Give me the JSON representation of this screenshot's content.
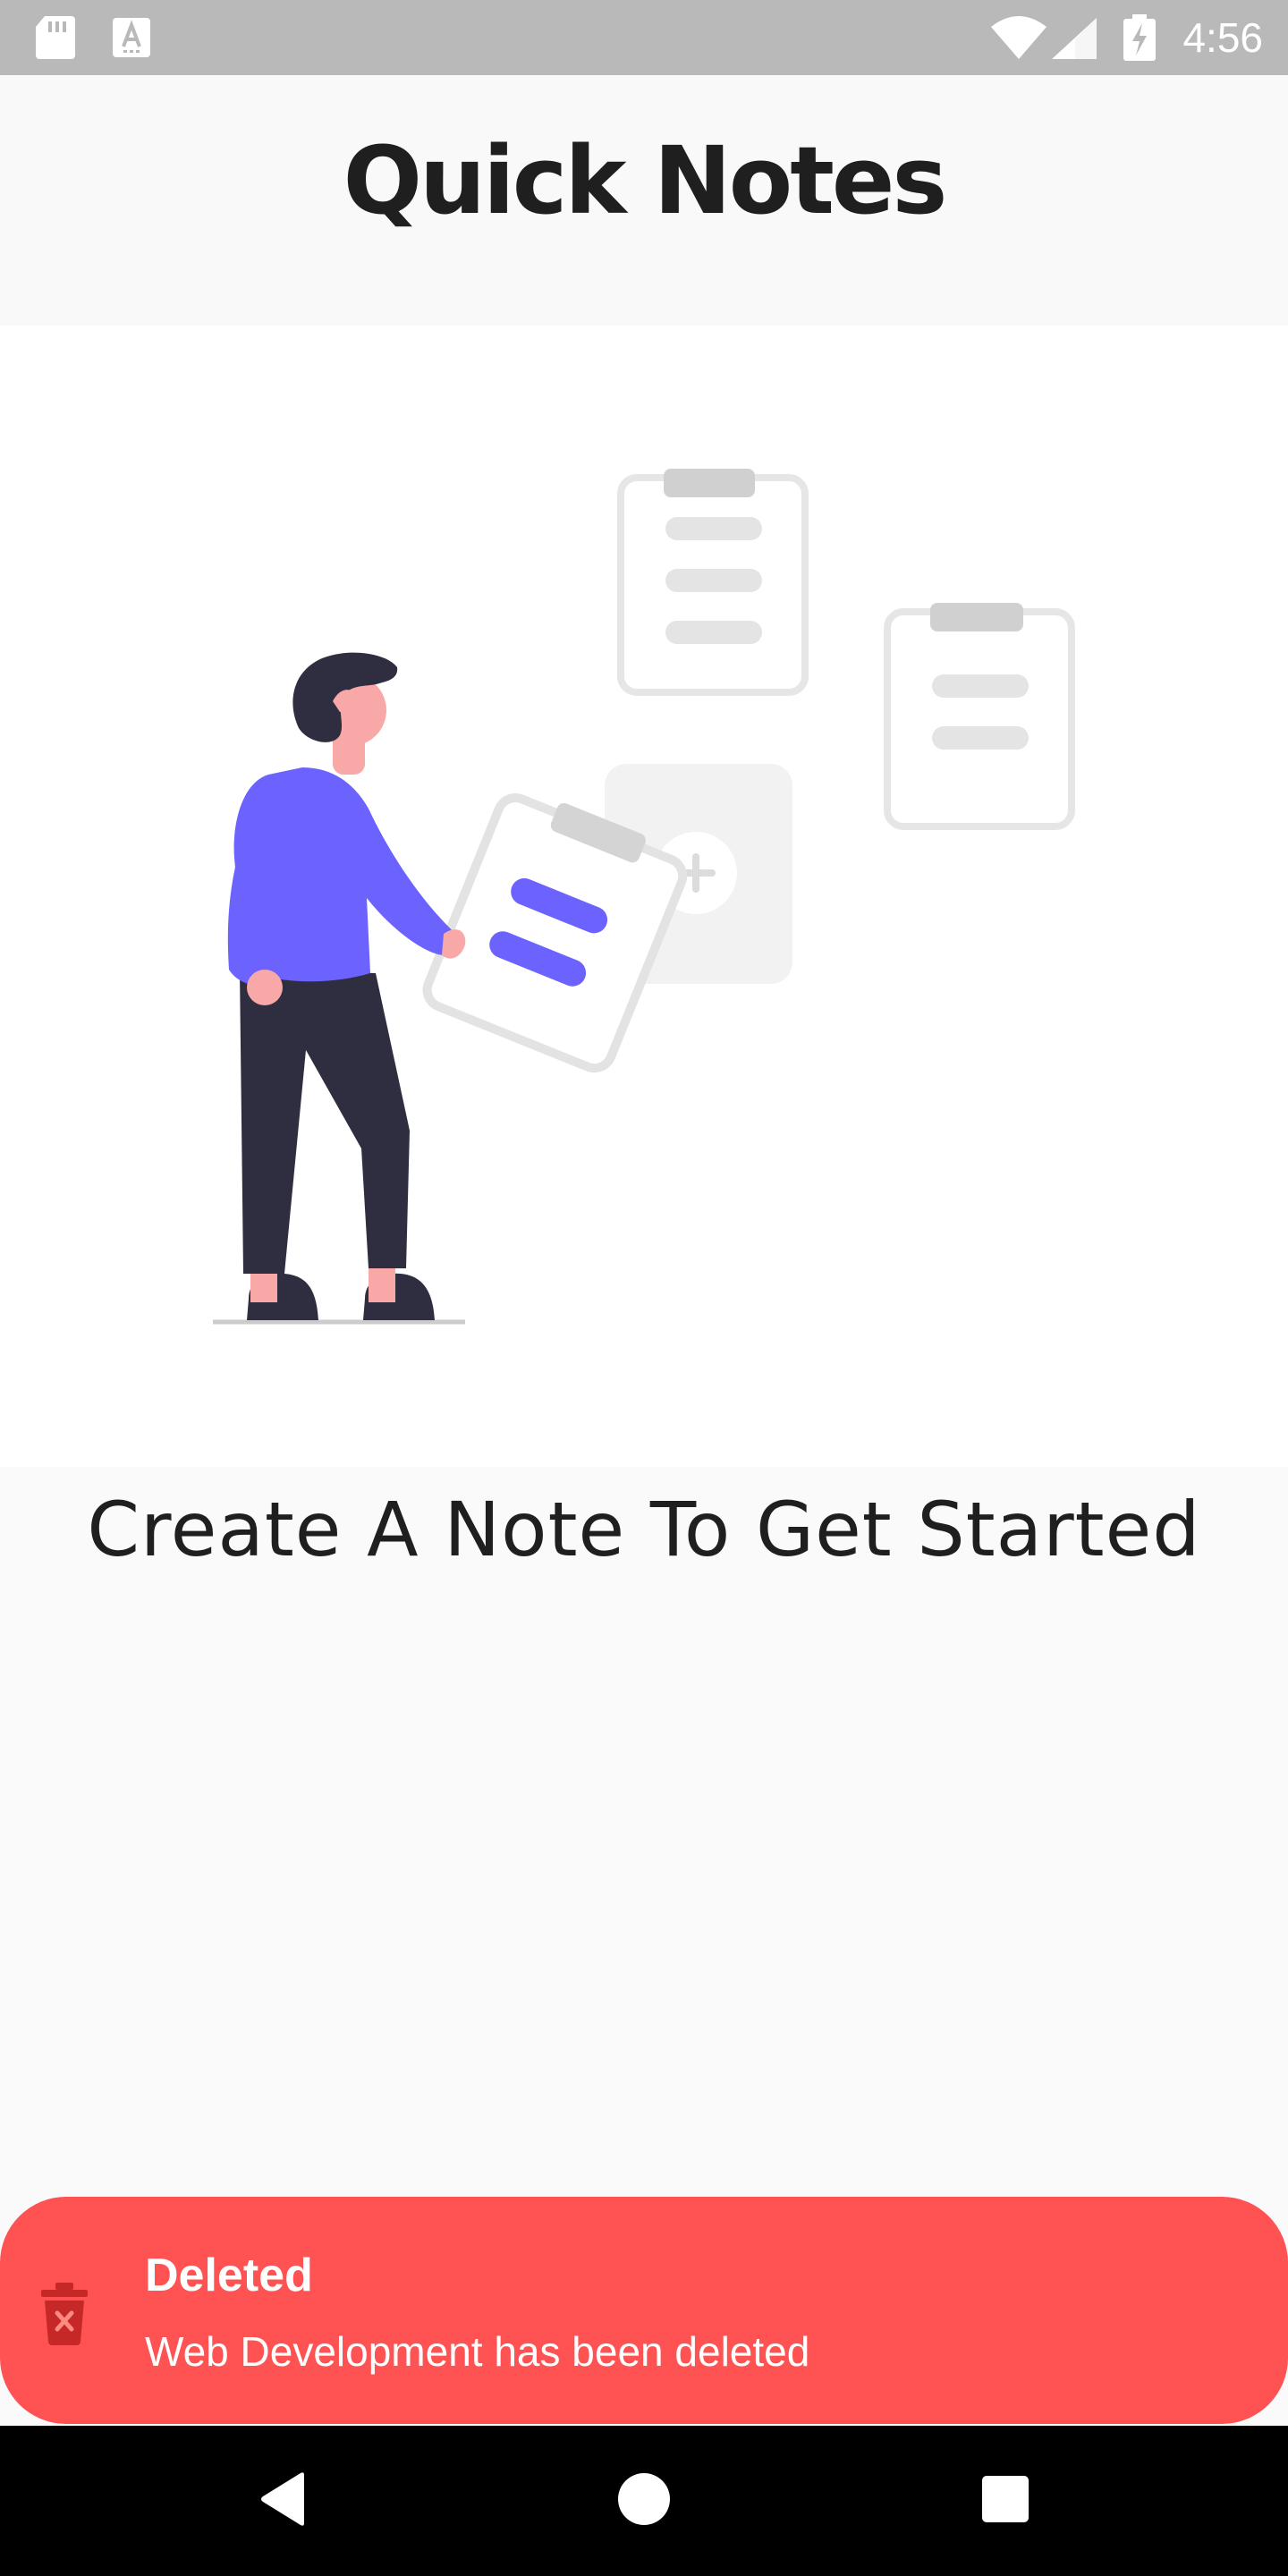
{
  "status_bar": {
    "time": "4:56",
    "icons": [
      "sd-card-icon",
      "a-notification-icon",
      "wifi-icon",
      "cell-signal-icon",
      "battery-charging-icon"
    ]
  },
  "header": {
    "title": "Quick Notes"
  },
  "empty_state": {
    "illustration": "person-with-clipboard-illustration",
    "message": "Create A Note To Get Started"
  },
  "snackbar": {
    "icon": "trash-icon",
    "title": "Deleted",
    "message": "Web Development has been deleted",
    "color": "#ff5252"
  },
  "nav_bar": {
    "buttons": [
      "back-icon",
      "home-icon",
      "recents-icon"
    ]
  },
  "colors": {
    "accent": "#6c63ff",
    "background": "#fafafa",
    "text": "#1f1f1f"
  }
}
